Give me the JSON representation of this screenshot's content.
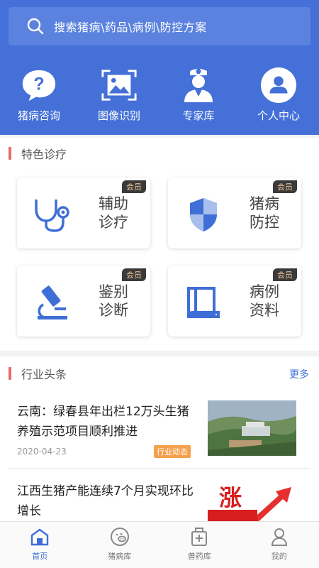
{
  "search": {
    "placeholder": "搜索猪病\\药品\\病例\\防控方案"
  },
  "quick_nav": [
    {
      "label": "猪病咨询",
      "icon": "question-chat-icon"
    },
    {
      "label": "图像识别",
      "icon": "image-scan-icon"
    },
    {
      "label": "专家库",
      "icon": "doctor-icon"
    },
    {
      "label": "个人中心",
      "icon": "user-icon"
    }
  ],
  "featured": {
    "title": "特色诊疗",
    "cards": [
      {
        "label": "辅助诊疗",
        "badge": "会员",
        "icon": "stethoscope-icon"
      },
      {
        "label": "猪病防控",
        "badge": "会员",
        "icon": "shield-icon"
      },
      {
        "label": "鉴别诊断",
        "badge": "会员",
        "icon": "microscope-icon"
      },
      {
        "label": "病例资料",
        "badge": "会员",
        "icon": "book-icon"
      }
    ]
  },
  "news": {
    "title": "行业头条",
    "more_label": "更多",
    "items": [
      {
        "title": "云南：绿春县年出栏12万头生猪养殖示范项目顺利推进",
        "date": "2020-04-23",
        "tag": "行业动态"
      },
      {
        "title": "江西生猪产能连续7个月实现环比增长",
        "image_text": "涨"
      }
    ]
  },
  "tabbar": [
    {
      "label": "首页",
      "icon": "home-icon",
      "active": true
    },
    {
      "label": "猪病库",
      "icon": "pig-icon",
      "active": false
    },
    {
      "label": "兽药库",
      "icon": "medicine-box-icon",
      "active": false
    },
    {
      "label": "我的",
      "icon": "profile-icon",
      "active": false
    }
  ],
  "colors": {
    "primary": "#4470d8",
    "accent_bar": "#e66a6a",
    "tag": "#f5a04a",
    "active_tab": "#3f6fd6"
  }
}
